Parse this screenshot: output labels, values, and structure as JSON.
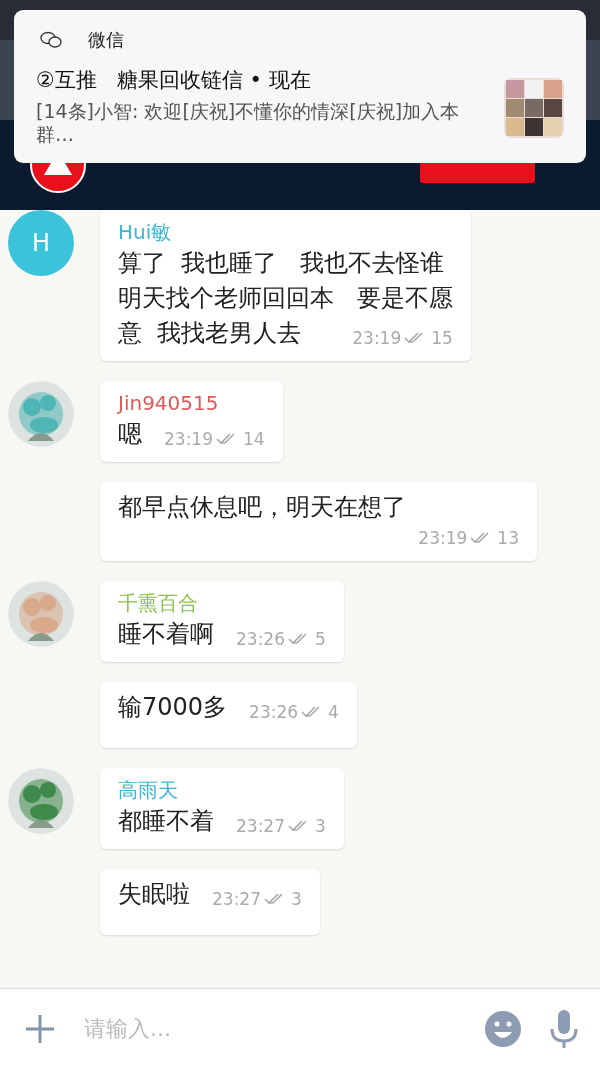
{
  "notification": {
    "app": "微信",
    "title": "②互推   糖果回收链信",
    "time": "• 现在",
    "body": "[14条]小智: 欢迎[庆祝]不懂你的情深[庆祝]加入本群…"
  },
  "messages": [
    {
      "sender": {
        "name": "Hui敏",
        "color": "#3bb5d3"
      },
      "avatar": {
        "kind": "letter",
        "letter": "H",
        "color": "#3cc3dc"
      },
      "lines": [
        "算了  我也睡了   我也不去怪谁",
        "明天找个老师回回本   要是不愿",
        "意  我找老男人去"
      ],
      "time": "23:19",
      "reads": "15"
    },
    {
      "sender": {
        "name": "Jin940515",
        "color": "#e05858"
      },
      "lines": [
        "嗯"
      ],
      "time": "23:19",
      "reads": "14"
    },
    {
      "lines": [
        "都早点休息吧，明天在想了"
      ],
      "time": "23:19",
      "reads": "13"
    },
    {
      "sender": {
        "name": "千熏百合",
        "color": "#8cc152"
      },
      "lines": [
        "睡不着啊"
      ],
      "time": "23:26",
      "reads": "5"
    },
    {
      "lines": [
        "输7000多"
      ],
      "time": "23:26",
      "reads": "4"
    },
    {
      "sender": {
        "name": "高雨天",
        "color": "#3bb5d3"
      },
      "lines": [
        "都睡不着"
      ],
      "time": "23:27",
      "reads": "3"
    },
    {
      "lines": [
        "失眠啦"
      ],
      "time": "23:27",
      "reads": "3"
    }
  ],
  "input": {
    "placeholder": "请输入..."
  }
}
